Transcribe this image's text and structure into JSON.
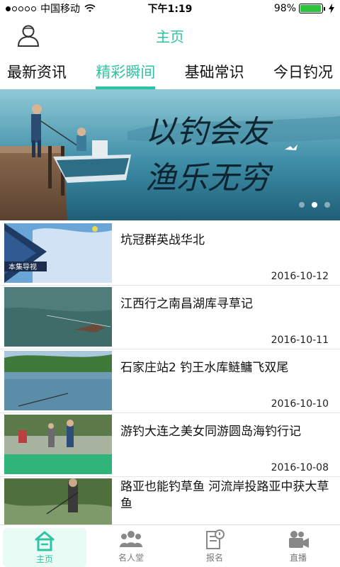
{
  "status_bar": {
    "carrier": "中国移动",
    "time": "下午1:19",
    "battery": "98%",
    "battery_level": 0.98
  },
  "header": {
    "title": "主页"
  },
  "tabs": [
    {
      "label": "最新资讯",
      "active": false
    },
    {
      "label": "精彩瞬间",
      "active": true
    },
    {
      "label": "基础常识",
      "active": false
    },
    {
      "label": "今日钓况",
      "active": false
    }
  ],
  "banner": {
    "line1": "以钓会友",
    "line2": "渔乐无穷",
    "slide_count": 3,
    "active_slide": 2
  },
  "news": [
    {
      "title": "坑冠群英战华北",
      "date": "2016-10-12",
      "thumb_caption": "本集导视"
    },
    {
      "title": "江西行之南昌湖库寻草记",
      "date": "2016-10-11"
    },
    {
      "title": "石家庄站2 钓王水库鲢鳙飞双尾",
      "date": "2016-10-10"
    },
    {
      "title": "游钓大连之美女同游圆岛海钓行记",
      "date": "2016-10-08"
    },
    {
      "title": "路亚也能钓草鱼 河流岸投路亚中获大草鱼",
      "date": ""
    }
  ],
  "bottom_nav": [
    {
      "label": "主页",
      "icon": "home-icon",
      "active": true
    },
    {
      "label": "名人堂",
      "icon": "people-icon",
      "active": false
    },
    {
      "label": "报名",
      "icon": "signup-icon",
      "active": false
    },
    {
      "label": "直播",
      "icon": "camera-icon",
      "active": false
    }
  ],
  "colors": {
    "accent": "#2ec4a3",
    "battery": "#2bc43c"
  }
}
